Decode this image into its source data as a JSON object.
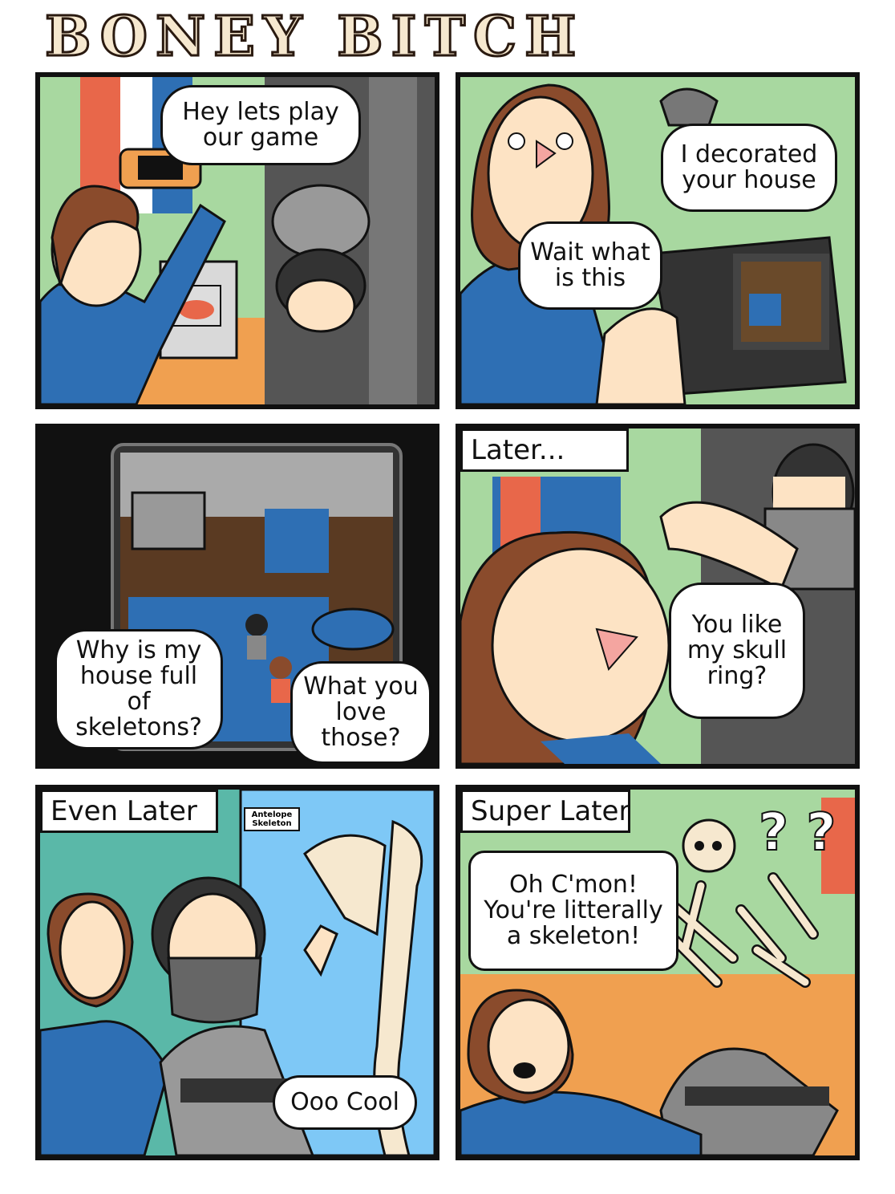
{
  "title": "BONEY BITCH",
  "colors": {
    "wall_green": "#a8d8a0",
    "floor_orange": "#f0a050",
    "shirt_blue": "#2e6fb4",
    "skin": "#fde3c4",
    "hair_brown": "#8a4b2c",
    "bone": "#f6e8cf",
    "stripe_gray": "#9a9a9a",
    "dark_gray": "#3a3a3a",
    "museum_blue": "#7ec8f6",
    "museum_teal": "#5ab8a8"
  },
  "panels": [
    {
      "bubbles": [
        "Hey lets play our game"
      ]
    },
    {
      "bubbles": [
        "I decorated your house",
        "Wait what is this"
      ]
    },
    {
      "bubbles": [
        "Why is my house full of skeletons?",
        "What you love those?"
      ]
    },
    {
      "caption": "Later...",
      "bubbles": [
        "You like my skull ring?"
      ]
    },
    {
      "caption": "Even Later",
      "sign": "Antelope Skeleton",
      "bubbles": [
        "Ooo Cool"
      ]
    },
    {
      "caption": "Super Later",
      "bubbles": [
        "Oh C'mon! You're litterally a skeleton!"
      ],
      "marks": "? ?"
    }
  ]
}
